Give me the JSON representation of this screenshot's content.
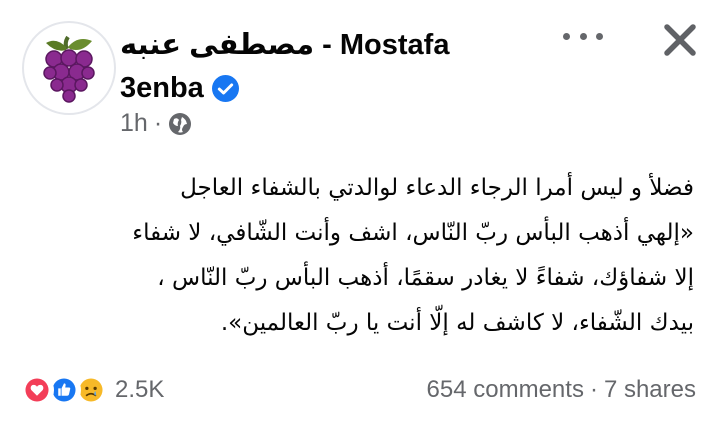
{
  "header": {
    "author_line1": "مصطفى عنبه - Mostafa",
    "author_line2": "3enba",
    "time": "1h",
    "separator": "·",
    "more_icon": "more-horizontal-icon",
    "close_icon": "close-icon",
    "verified_color": "#1877f2"
  },
  "post": {
    "lines": [
      "فضلأ و ليس أمرا الرجاء الدعاء لوالدتي بالشفاء العاجل",
      "«إلهي أذهب البأس ربّ النّاس، اشف وأنت الشّافي، لا شفاء",
      "إلا شفاؤك، شفاءً لا يغادر سقمًا، أذهب البأس ربّ النّاس ،",
      "بيدك الشّفاء، لا كاشف له إلّا أنت يا ربّ العالمين»."
    ]
  },
  "footer": {
    "reaction_icons": [
      "love-icon",
      "like-icon",
      "sad-icon"
    ],
    "reaction_count": "2.5K",
    "comments": "654 comments",
    "dot": "·",
    "shares": "7 shares"
  }
}
